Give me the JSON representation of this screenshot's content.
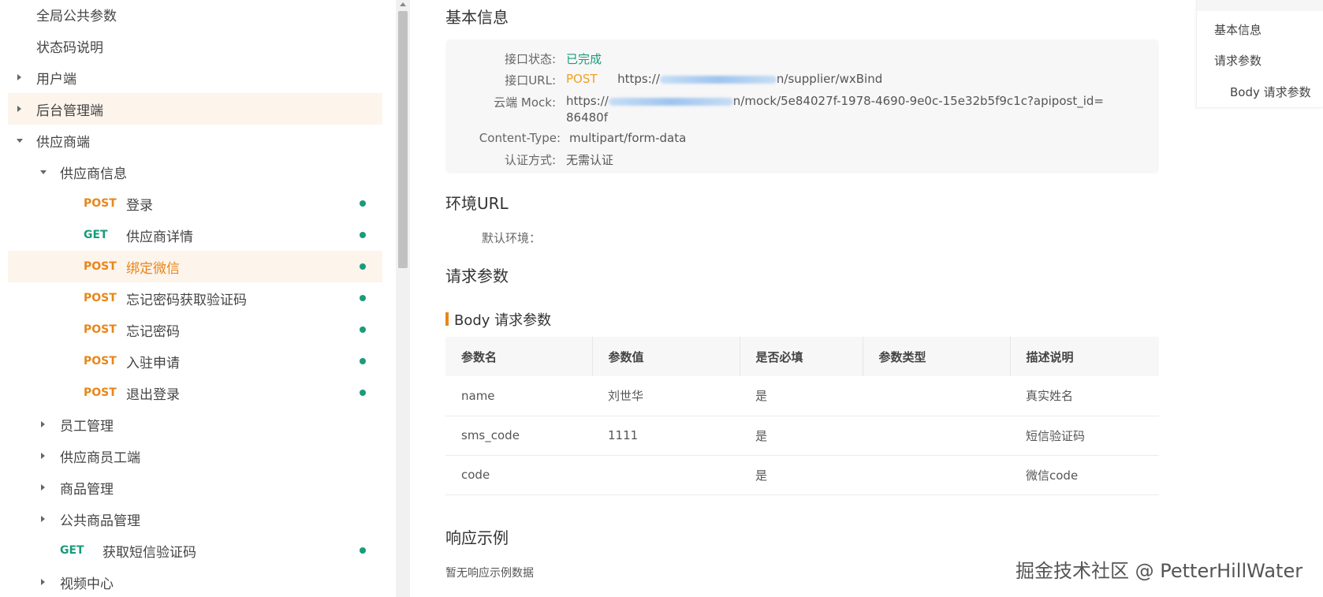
{
  "sidebar": {
    "items": [
      {
        "label": "全局公共参数"
      },
      {
        "label": "状态码说明"
      },
      {
        "label": "用户端"
      },
      {
        "label": "后台管理端"
      },
      {
        "label": "供应商端"
      },
      {
        "label": "供应商信息"
      },
      {
        "label": "登录",
        "method": "POST"
      },
      {
        "label": "供应商详情",
        "method": "GET"
      },
      {
        "label": "绑定微信",
        "method": "POST"
      },
      {
        "label": "忘记密码获取验证码",
        "method": "POST"
      },
      {
        "label": "忘记密码",
        "method": "POST"
      },
      {
        "label": "入驻申请",
        "method": "POST"
      },
      {
        "label": "退出登录",
        "method": "POST"
      },
      {
        "label": "员工管理"
      },
      {
        "label": "供应商员工端"
      },
      {
        "label": "商品管理"
      },
      {
        "label": "公共商品管理"
      },
      {
        "label": "获取短信验证码",
        "method": "GET"
      },
      {
        "label": "视频中心"
      }
    ]
  },
  "main": {
    "basic_info_title": "基本信息",
    "status_key": "接口状态:",
    "status_value": "已完成",
    "url_key": "接口URL:",
    "url_method": "POST",
    "url_prefix": "https://",
    "url_suffix": "n/supplier/wxBind",
    "mock_key": "云端 Mock:",
    "mock_prefix": "https://",
    "mock_suffix": "n/mock/5e84027f-1978-4690-9e0c-15e32b5f9c1c?apipost_id=",
    "mock_line2": "86480f",
    "content_type_key": "Content-Type:",
    "content_type_value": "multipart/form-data",
    "auth_key": "认证方式:",
    "auth_value": "无需认证",
    "env_title": "环境URL",
    "env_default_key": "默认环境：",
    "request_title": "请求参数",
    "body_title": "Body 请求参数",
    "table": {
      "headers": [
        "参数名",
        "参数值",
        "是否必填",
        "参数类型",
        "描述说明"
      ],
      "rows": [
        [
          "name",
          "刘世华",
          "是",
          "",
          "真实姓名"
        ],
        [
          "sms_code",
          "1111",
          "是",
          "",
          "短信验证码"
        ],
        [
          "code",
          "",
          "是",
          "",
          "微信code"
        ]
      ]
    },
    "response_title": "响应示例",
    "response_empty": "暂无响应示例数据"
  },
  "toc": {
    "items": [
      "基本信息",
      "请求参数",
      "Body 请求参数"
    ]
  },
  "watermark": "掘金技术社区 @ PetterHillWater",
  "colors": {
    "post": "#e8861a",
    "get": "#1a9b7a",
    "highlight": "#fdf4ec"
  }
}
